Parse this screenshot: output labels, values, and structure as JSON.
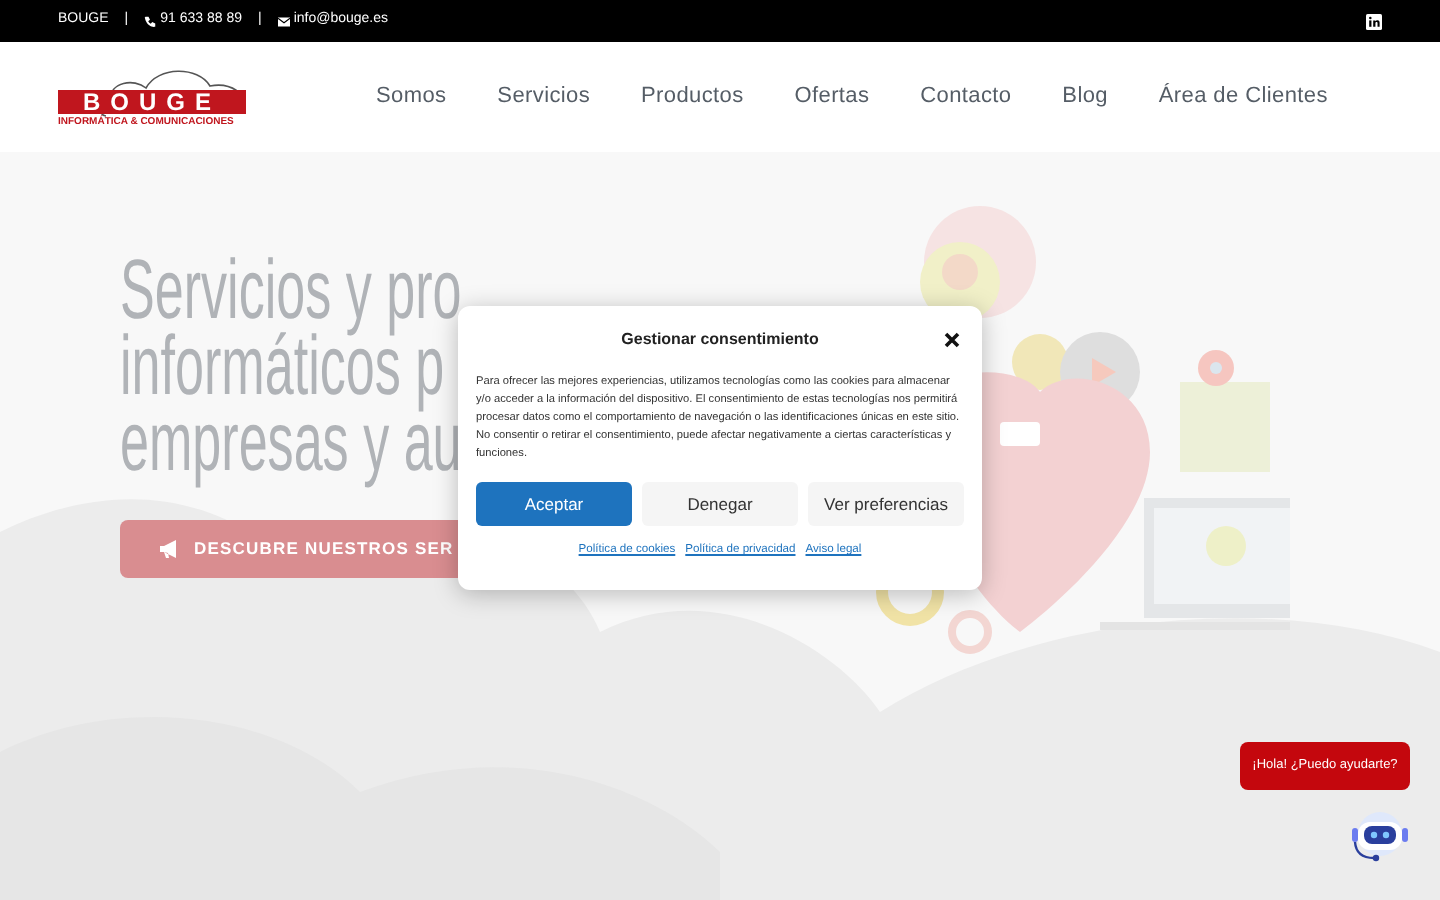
{
  "top_bar": {
    "items": [
      {
        "kind": "text",
        "text": "BOUGE"
      },
      {
        "kind": "separator",
        "text": "|"
      },
      {
        "kind": "phone",
        "text": "91 633 88 89"
      },
      {
        "kind": "separator",
        "text": "|"
      },
      {
        "kind": "email",
        "text": "info@bouge.es"
      }
    ]
  },
  "header": {
    "logo": {
      "name": "BOUGE",
      "tagline": "INFORMÁTICA & COMUNICACIONES"
    },
    "menu": [
      "Somos",
      "Servicios",
      "Productos",
      "Ofertas",
      "Contacto",
      "Blog",
      "Área de Clientes"
    ]
  },
  "hero": {
    "heading_lines": [
      "Servicios y pro",
      "informáticos p",
      "empresas y au"
    ],
    "button": "DESCUBRE NUESTROS SER"
  },
  "consent": {
    "title": "Gestionar consentimiento",
    "body": "Para ofrecer las mejores experiencias, utilizamos tecnologías como las cookies para almacenar y/o acceder a la información del dispositivo. El consentimiento de estas tecnologías nos permitirá procesar datos como el comportamiento de navegación o las identificaciones únicas en este sitio. No consentir o retirar el consentimiento, puede afectar negativamente a ciertas características y funciones.",
    "buttons": [
      {
        "label": "Aceptar",
        "kind": "primary"
      },
      {
        "label": "Denegar",
        "kind": "secondary"
      },
      {
        "label": "Ver preferencias",
        "kind": "secondary"
      }
    ],
    "links": [
      "Política de cookies",
      "Política de privacidad",
      "Aviso legal"
    ]
  },
  "chat": {
    "greeting": "¡Hola! ¿Puedo ayudarte?"
  }
}
